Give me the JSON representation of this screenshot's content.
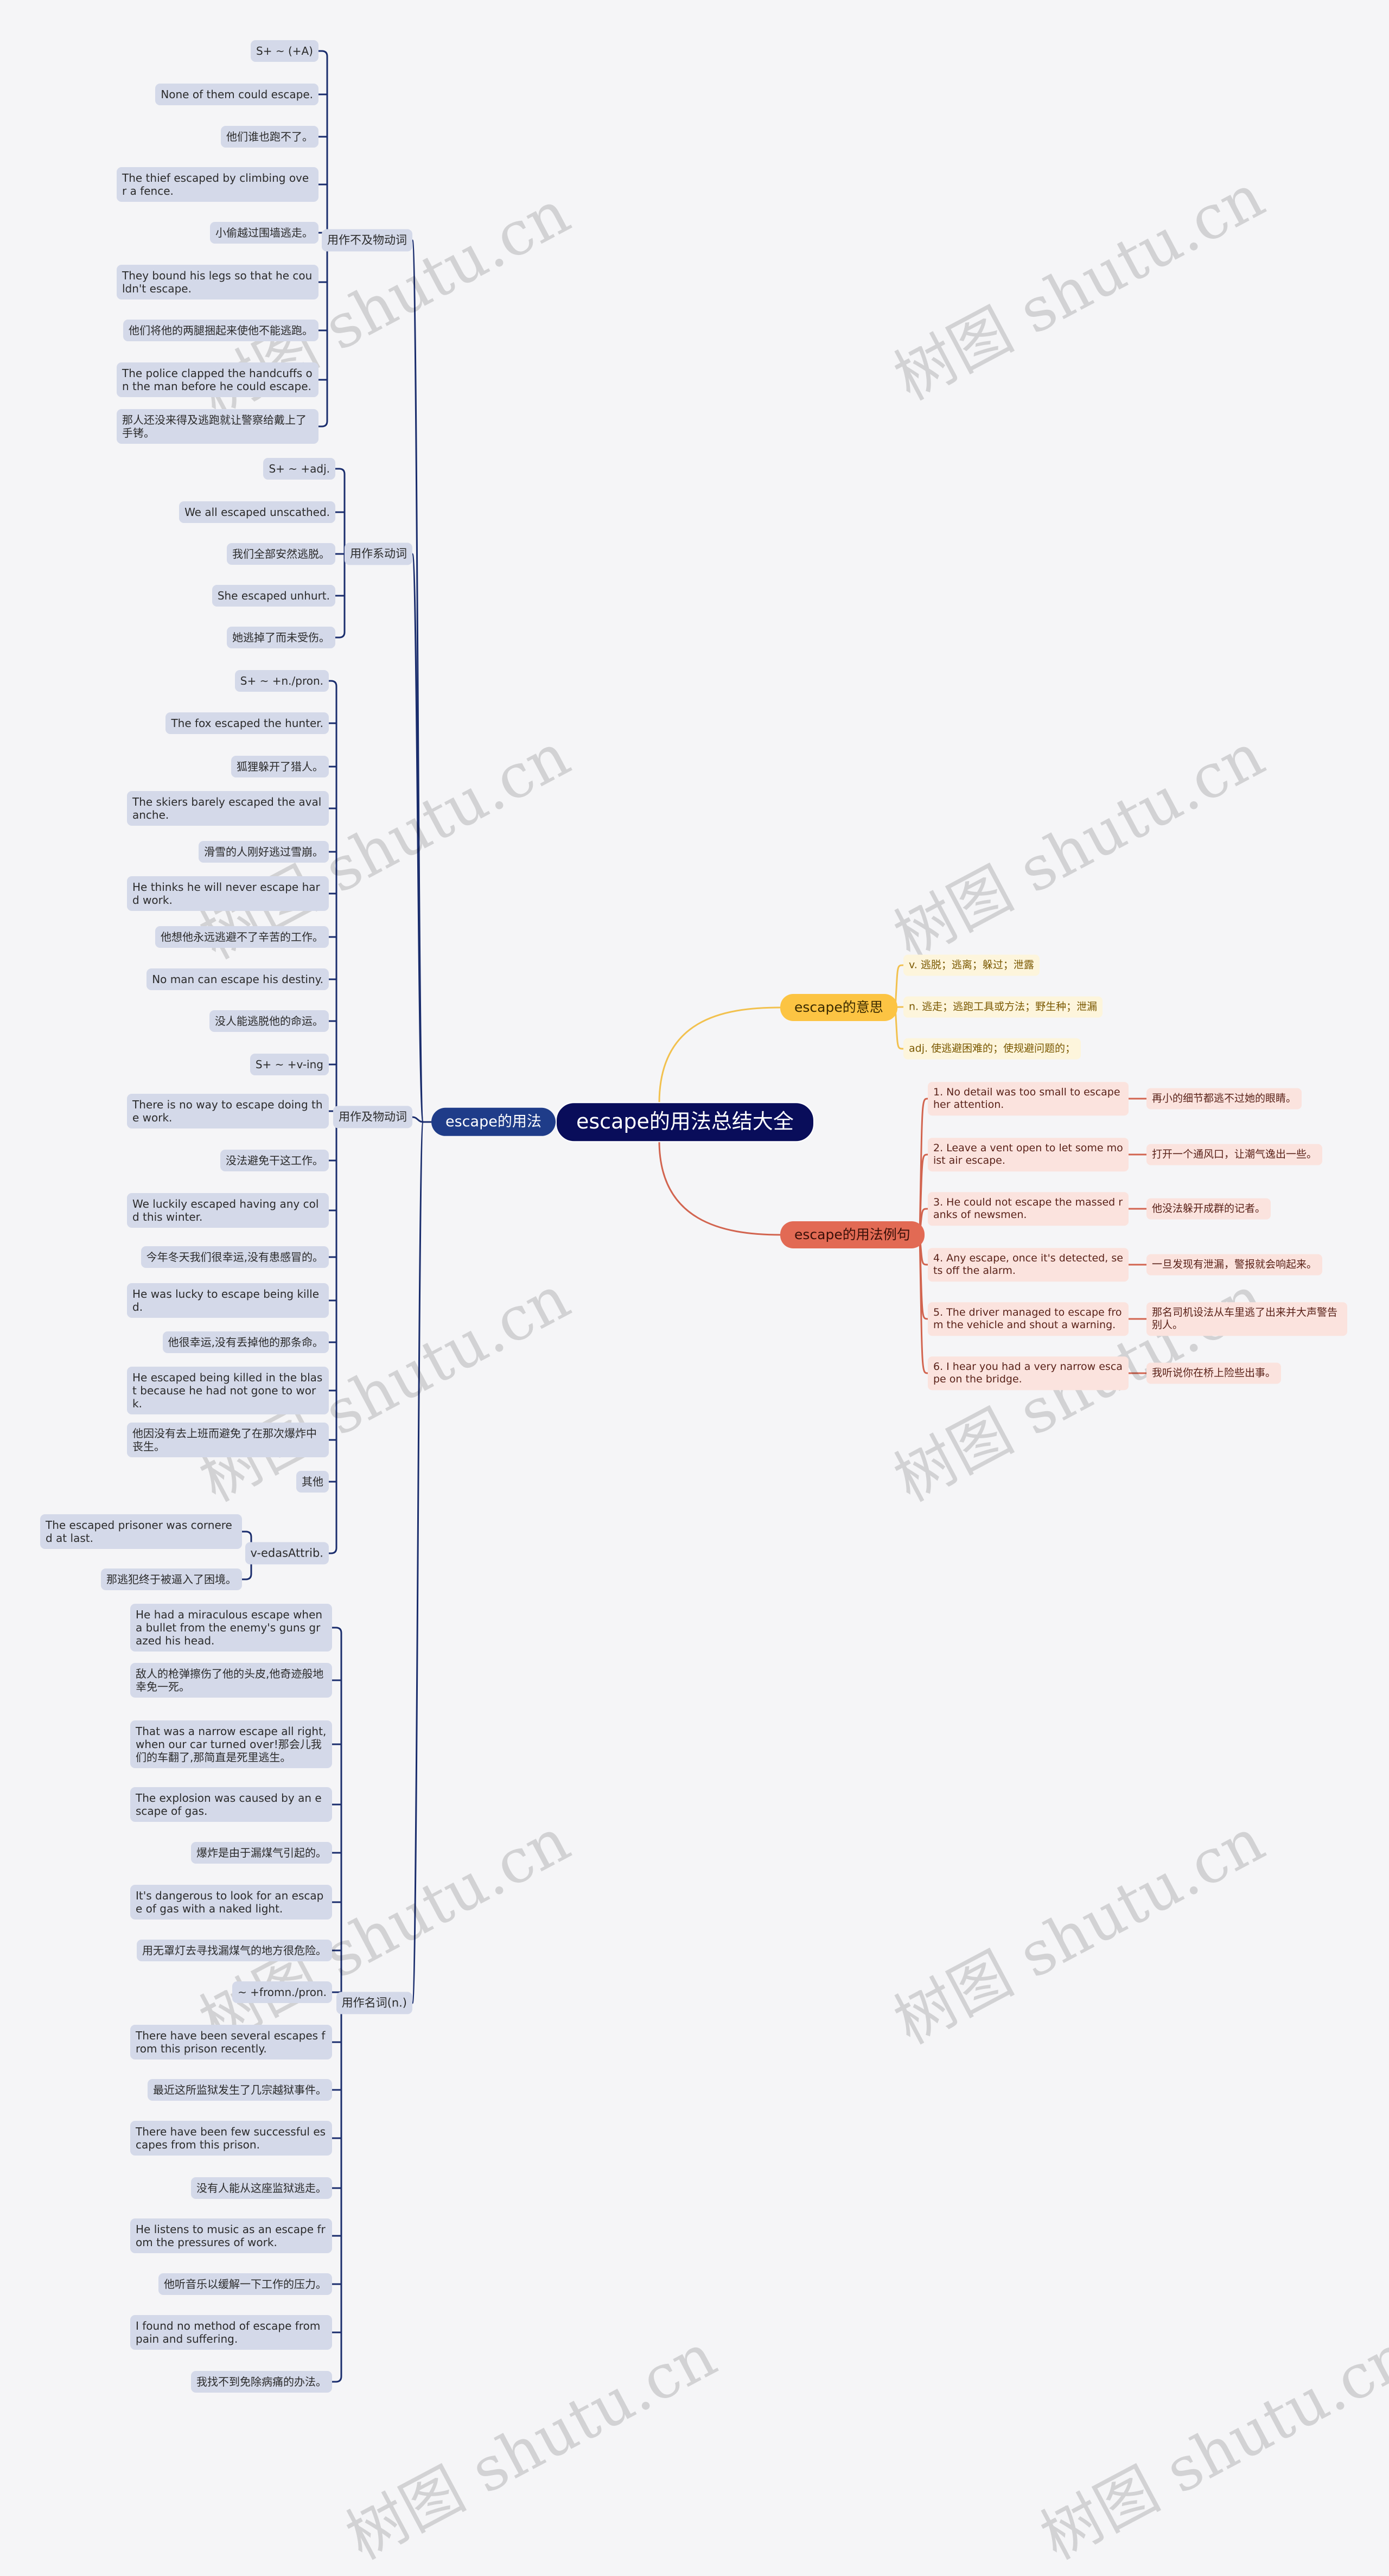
{
  "root": {
    "label": "escape的用法总结大全"
  },
  "colors": {
    "background": "#f5f5f7",
    "root": "#090d5a",
    "usage_branch": "#1f3c89",
    "usage_leaf": "#d4d9e9",
    "meaning_branch": "#fcc443",
    "meaning_leaf": "#fdf5dc",
    "example_branch": "#e26a54",
    "example_leaf": "#fbe3de"
  },
  "usage": {
    "label": "escape的用法",
    "groups": [
      {
        "label": "用作不及物动词",
        "items": [
          {
            "label": "S+ ~ (+A)"
          },
          {
            "label": "None of them could escape."
          },
          {
            "label": "他们谁也跑不了。"
          },
          {
            "label": "The thief escaped by climbing over a fence."
          },
          {
            "label": "小偷越过围墙逃走。"
          },
          {
            "label": "They bound his legs so that he couldn't escape."
          },
          {
            "label": "他们将他的两腿捆起来使他不能逃跑。"
          },
          {
            "label": "The police clapped the handcuffs on the man before he could escape."
          },
          {
            "label": "那人还没来得及逃跑就让警察给戴上了手铐。"
          }
        ]
      },
      {
        "label": "用作系动词",
        "items": [
          {
            "label": "S+ ~ +adj."
          },
          {
            "label": "We all escaped unscathed."
          },
          {
            "label": "我们全部安然逃脱。"
          },
          {
            "label": "She escaped unhurt."
          },
          {
            "label": "她逃掉了而未受伤。"
          }
        ]
      },
      {
        "label": "用作及物动词",
        "items": [
          {
            "label": "S+ ~ +n./pron."
          },
          {
            "label": "The fox escaped the hunter."
          },
          {
            "label": "狐狸躲开了猎人。"
          },
          {
            "label": "The skiers barely escaped the avalanche."
          },
          {
            "label": "滑雪的人刚好逃过雪崩。"
          },
          {
            "label": "He thinks he will never escape hard work."
          },
          {
            "label": "他想他永远逃避不了辛苦的工作。"
          },
          {
            "label": "No man can escape his destiny."
          },
          {
            "label": "没人能逃脱他的命运。"
          },
          {
            "label": "S+ ~ +v-ing"
          },
          {
            "label": "There is no way to escape doing the work."
          },
          {
            "label": "没法避免干这工作。"
          },
          {
            "label": "We luckily escaped having any cold this winter."
          },
          {
            "label": "今年冬天我们很幸运,没有患感冒的。"
          },
          {
            "label": "He was lucky to escape being killed."
          },
          {
            "label": "他很幸运,没有丢掉他的那条命。"
          },
          {
            "label": "He escaped being killed in the blast because he had not gone to work."
          },
          {
            "label": "他因没有去上班而避免了在那次爆炸中丧生。"
          },
          {
            "label": "其他"
          },
          {
            "label": "v-edasAttrib.",
            "children": [
              {
                "label": "The escaped prisoner was cornered at last."
              },
              {
                "label": "那逃犯终于被逼入了困境。"
              }
            ]
          }
        ]
      },
      {
        "label": "用作名词(n.)",
        "items": [
          {
            "label": "He had a miraculous escape when a bullet from the enemy's guns grazed his head."
          },
          {
            "label": "敌人的枪弹擦伤了他的头皮,他奇迹般地幸免一死。"
          },
          {
            "label": "That was a narrow escape all right, when our car turned over!那会儿我们的车翻了,那简直是死里逃生。"
          },
          {
            "label": "The explosion was caused by an escape of gas."
          },
          {
            "label": "爆炸是由于漏煤气引起的。"
          },
          {
            "label": "It's dangerous to look for an escape of gas with a naked light."
          },
          {
            "label": "用无罩灯去寻找漏煤气的地方很危险。"
          },
          {
            "label": "~ +fromn./pron."
          },
          {
            "label": "There have been several escapes from this prison recently."
          },
          {
            "label": "最近这所监狱发生了几宗越狱事件。"
          },
          {
            "label": "There have been few successful escapes from this prison."
          },
          {
            "label": "没有人能从这座监狱逃走。"
          },
          {
            "label": "He listens to music as an escape from the pressures of work."
          },
          {
            "label": "他听音乐以缓解一下工作的压力。"
          },
          {
            "label": "I found no method of escape from pain and suffering."
          },
          {
            "label": "我找不到免除病痛的办法。"
          }
        ]
      }
    ]
  },
  "meaning": {
    "label": "escape的意思",
    "items": [
      "v. 逃脱；逃离；躲过；泄露",
      "n. 逃走；逃跑工具或方法；野生种；泄漏",
      "adj. 使逃避困难的；使规避问题的；"
    ]
  },
  "examples": {
    "label": "escape的用法例句",
    "items": [
      {
        "en": "1. No detail was too small to escape her attention.",
        "zh": "再小的细节都逃不过她的眼睛。"
      },
      {
        "en": "2. Leave a vent open to let some moist air escape.",
        "zh": "打开一个通风口，让潮气逸出一些。"
      },
      {
        "en": "3. He could not escape the massed ranks of newsmen.",
        "zh": "他没法躲开成群的记者。"
      },
      {
        "en": "4. Any escape, once it's detected, sets off the alarm.",
        "zh": "一旦发现有泄漏，警报就会响起来。"
      },
      {
        "en": "5. The driver managed to escape from the vehicle and shout a warning.",
        "zh": "那名司机设法从车里逃了出来并大声警告别人。"
      },
      {
        "en": "6. I hear you had a very narrow escape on the bridge.",
        "zh": "我听说你在桥上险些出事。"
      }
    ]
  },
  "watermark": {
    "text": "树图 shutu.cn"
  }
}
